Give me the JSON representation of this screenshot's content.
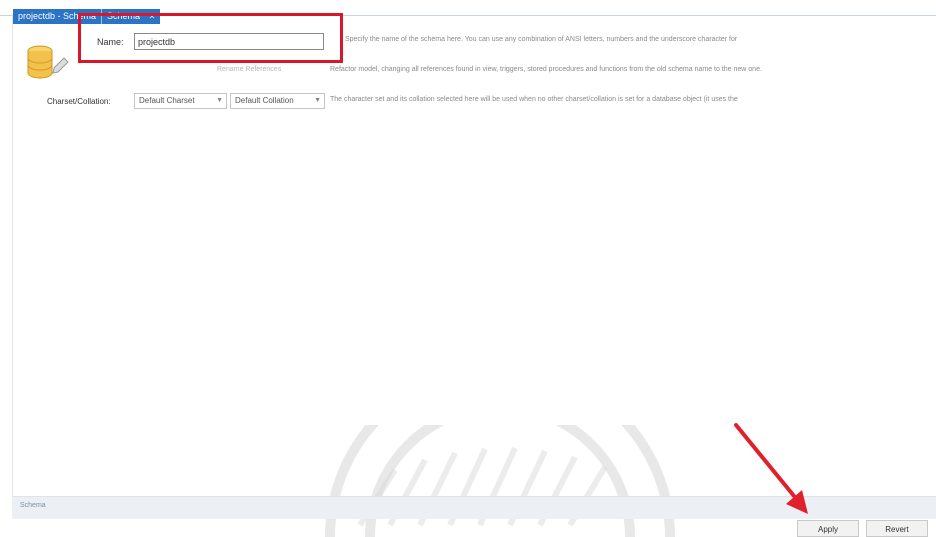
{
  "tabs": [
    {
      "label": "projectdb - Schema",
      "active": false
    },
    {
      "label": "Schema",
      "active": true
    }
  ],
  "icons": {
    "database": "database-icon",
    "tab_close": "close-icon",
    "select_chevron": "chevron-down-icon",
    "annotation_arrow": "arrow-icon"
  },
  "form": {
    "name_label": "Name:",
    "name_value": "projectdb",
    "rename_label": "Rename References",
    "charset_label": "Charset/Collation:",
    "charset_value": "Default Charset",
    "collation_value": "Default Collation"
  },
  "descriptions": {
    "name": "Specify the name of the schema here. You can use any combination of ANSI letters, numbers and the underscore character for",
    "rename": "Refactor model, changing all references found in view, triggers, stored procedures and functions from the old schema name to the new one.",
    "charset": "The character set and its collation selected here will be used when no other charset/collation is set for a database object (it uses the"
  },
  "bottom_tabs": [
    {
      "label": "Schema"
    }
  ],
  "buttons": {
    "apply": "Apply",
    "revert": "Revert"
  },
  "colors": {
    "accent_tab": "#2b73c4",
    "highlight_red": "#d8182a"
  }
}
